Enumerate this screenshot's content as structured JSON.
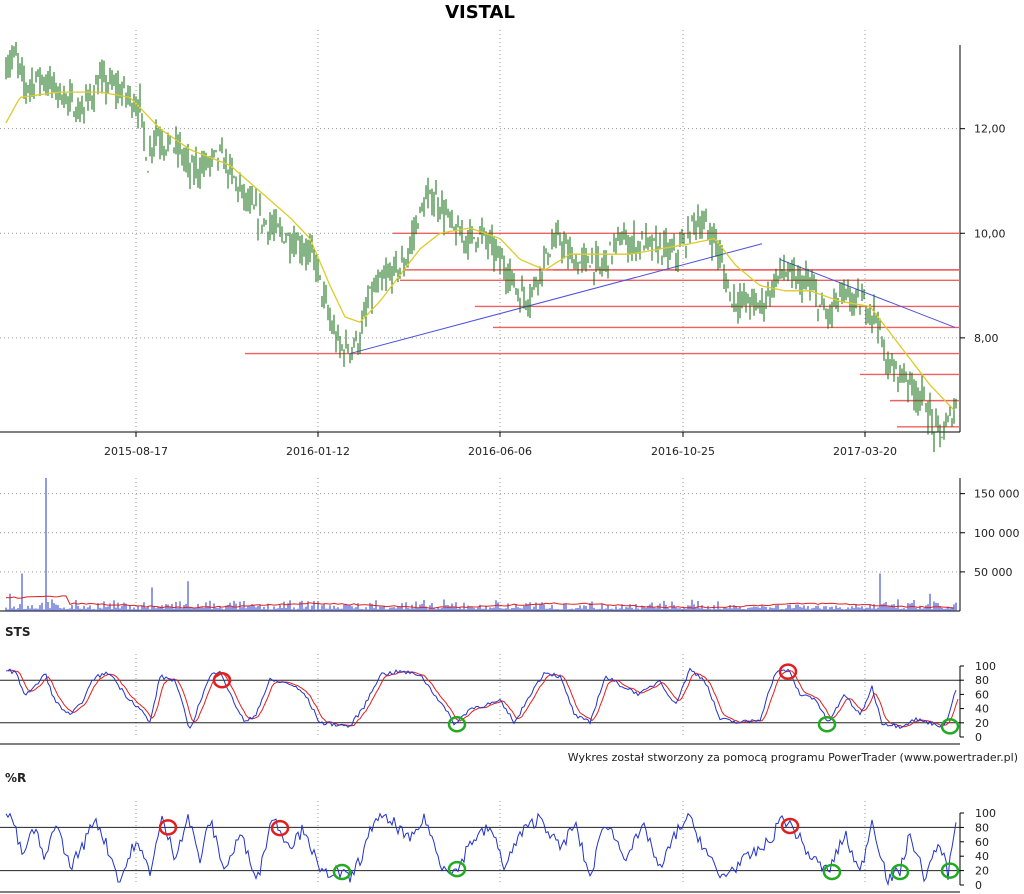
{
  "chart_data": {
    "type": "line",
    "title": "VISTAL",
    "credit": "Wykres został stworzony za pomocą programu PowerTrader (www.powertrader.pl)",
    "x_dates": [
      "2015-08-17",
      "2016-01-12",
      "2016-06-06",
      "2016-10-25",
      "2017-03-20"
    ],
    "colors": {
      "price": "#0b6b0b",
      "ma": "#dccb29",
      "trend": "#4a52e0",
      "levels": "#f06060",
      "volume": "#2233cc",
      "volume_avg": "#e02020",
      "sts_k": "#2233cc",
      "sts_d": "#e02020",
      "wr": "#2233cc",
      "sell_mark": "#e02020",
      "buy_mark": "#22aa22"
    },
    "price": {
      "y_ticks": [
        "12,00",
        "10,00",
        "8,00"
      ],
      "y_values": [
        12,
        10,
        8
      ],
      "ylim": [
        6.2,
        13.6
      ],
      "series_name": "close",
      "anchors": [
        [
          0,
          13.1
        ],
        [
          15,
          13.4
        ],
        [
          25,
          12.8
        ],
        [
          40,
          13.0
        ],
        [
          60,
          12.7
        ],
        [
          80,
          12.3
        ],
        [
          100,
          12.9
        ],
        [
          115,
          12.8
        ],
        [
          130,
          12.6
        ],
        [
          140,
          12.4
        ],
        [
          148,
          11.3
        ],
        [
          155,
          12.0
        ],
        [
          165,
          11.7
        ],
        [
          180,
          11.6
        ],
        [
          190,
          11.2
        ],
        [
          205,
          11.3
        ],
        [
          220,
          11.5
        ],
        [
          235,
          11.0
        ],
        [
          250,
          10.5
        ],
        [
          265,
          10.2
        ],
        [
          280,
          10.0
        ],
        [
          300,
          9.8
        ],
        [
          315,
          9.5
        ],
        [
          322,
          8.9
        ],
        [
          330,
          8.3
        ],
        [
          340,
          7.8
        ],
        [
          350,
          7.8
        ],
        [
          360,
          8.0
        ],
        [
          370,
          8.8
        ],
        [
          380,
          9.0
        ],
        [
          395,
          9.3
        ],
        [
          405,
          9.4
        ],
        [
          415,
          10.1
        ],
        [
          425,
          10.6
        ],
        [
          435,
          10.7
        ],
        [
          445,
          10.4
        ],
        [
          455,
          10.0
        ],
        [
          470,
          9.9
        ],
        [
          480,
          10.0
        ],
        [
          490,
          9.8
        ],
        [
          500,
          9.5
        ],
        [
          510,
          9.2
        ],
        [
          520,
          8.8
        ],
        [
          530,
          8.8
        ],
        [
          540,
          9.3
        ],
        [
          550,
          9.7
        ],
        [
          560,
          9.9
        ],
        [
          568,
          9.6
        ],
        [
          578,
          9.4
        ],
        [
          590,
          9.5
        ],
        [
          600,
          9.3
        ],
        [
          610,
          9.6
        ],
        [
          620,
          9.9
        ],
        [
          630,
          9.8
        ],
        [
          645,
          9.8
        ],
        [
          660,
          9.7
        ],
        [
          675,
          9.6
        ],
        [
          685,
          9.8
        ],
        [
          695,
          10.3
        ],
        [
          705,
          10.1
        ],
        [
          715,
          9.9
        ],
        [
          722,
          9.4
        ],
        [
          730,
          8.8
        ],
        [
          740,
          8.7
        ],
        [
          750,
          8.7
        ],
        [
          760,
          8.6
        ],
        [
          770,
          8.9
        ],
        [
          782,
          9.3
        ],
        [
          795,
          9.1
        ],
        [
          810,
          9.0
        ],
        [
          820,
          8.6
        ],
        [
          828,
          8.4
        ],
        [
          840,
          8.8
        ],
        [
          855,
          8.7
        ],
        [
          868,
          8.6
        ],
        [
          878,
          8.4
        ],
        [
          884,
          7.6
        ],
        [
          892,
          7.4
        ],
        [
          905,
          7.3
        ],
        [
          915,
          7.0
        ],
        [
          925,
          6.8
        ],
        [
          935,
          6.2
        ],
        [
          945,
          6.2
        ],
        [
          955,
          6.7
        ]
      ],
      "ma_anchors": [
        [
          0,
          11.9
        ],
        [
          20,
          12.6
        ],
        [
          60,
          12.7
        ],
        [
          100,
          12.7
        ],
        [
          130,
          12.6
        ],
        [
          160,
          12.0
        ],
        [
          190,
          11.6
        ],
        [
          230,
          11.3
        ],
        [
          260,
          10.8
        ],
        [
          290,
          10.3
        ],
        [
          310,
          9.9
        ],
        [
          330,
          9.0
        ],
        [
          345,
          8.4
        ],
        [
          360,
          8.3
        ],
        [
          380,
          8.7
        ],
        [
          400,
          9.2
        ],
        [
          420,
          9.7
        ],
        [
          440,
          10.0
        ],
        [
          470,
          10.1
        ],
        [
          500,
          9.9
        ],
        [
          520,
          9.5
        ],
        [
          545,
          9.3
        ],
        [
          570,
          9.6
        ],
        [
          600,
          9.6
        ],
        [
          630,
          9.6
        ],
        [
          660,
          9.7
        ],
        [
          690,
          9.8
        ],
        [
          715,
          9.9
        ],
        [
          735,
          9.4
        ],
        [
          760,
          9.0
        ],
        [
          785,
          8.9
        ],
        [
          810,
          8.9
        ],
        [
          840,
          8.7
        ],
        [
          870,
          8.6
        ],
        [
          890,
          8.1
        ],
        [
          910,
          7.6
        ],
        [
          930,
          7.1
        ],
        [
          955,
          6.6
        ]
      ],
      "levels": [
        [
          393,
          960,
          10.0
        ],
        [
          403,
          960,
          9.3
        ],
        [
          400,
          960,
          9.1
        ],
        [
          475,
          960,
          8.6
        ],
        [
          493,
          960,
          8.2
        ],
        [
          553,
          960,
          9.3
        ],
        [
          245,
          960,
          7.7
        ],
        [
          860,
          960,
          7.3
        ],
        [
          890,
          960,
          6.8
        ],
        [
          897,
          960,
          6.3
        ]
      ],
      "trendlines": [
        [
          [
            350,
            7.7
          ],
          [
            762,
            9.8
          ]
        ],
        [
          [
            780,
            9.5
          ],
          [
            955,
            8.2
          ]
        ]
      ]
    },
    "volume": {
      "y_ticks": [
        "150 000",
        "100 000",
        "50 000"
      ],
      "y_values": [
        150000,
        100000,
        50000
      ],
      "ylim": [
        0,
        170000
      ],
      "spikes": [
        [
          9,
          22000
        ],
        [
          22,
          48000
        ],
        [
          45,
          170000
        ],
        [
          152,
          30000
        ],
        [
          188,
          38000
        ],
        [
          880,
          48000
        ],
        [
          930,
          22000
        ]
      ]
    },
    "sts": {
      "label": "STS",
      "y_ticks": [
        "100",
        "80",
        "60",
        "40",
        "20",
        "0"
      ],
      "y_values": [
        100,
        80,
        60,
        40,
        20,
        0
      ],
      "levels": [
        80,
        20
      ],
      "anchors": [
        [
          0,
          95
        ],
        [
          15,
          92
        ],
        [
          25,
          60
        ],
        [
          35,
          70
        ],
        [
          45,
          90
        ],
        [
          55,
          50
        ],
        [
          70,
          30
        ],
        [
          80,
          45
        ],
        [
          95,
          85
        ],
        [
          110,
          90
        ],
        [
          125,
          60
        ],
        [
          140,
          40
        ],
        [
          150,
          20
        ],
        [
          160,
          85
        ],
        [
          175,
          80
        ],
        [
          190,
          10
        ],
        [
          200,
          50
        ],
        [
          210,
          85
        ],
        [
          220,
          95
        ],
        [
          230,
          60
        ],
        [
          245,
          20
        ],
        [
          255,
          30
        ],
        [
          270,
          80
        ],
        [
          290,
          75
        ],
        [
          305,
          60
        ],
        [
          320,
          20
        ],
        [
          335,
          18
        ],
        [
          350,
          15
        ],
        [
          365,
          45
        ],
        [
          380,
          88
        ],
        [
          400,
          92
        ],
        [
          420,
          88
        ],
        [
          440,
          50
        ],
        [
          455,
          18
        ],
        [
          470,
          40
        ],
        [
          485,
          45
        ],
        [
          500,
          50
        ],
        [
          515,
          20
        ],
        [
          530,
          60
        ],
        [
          545,
          92
        ],
        [
          560,
          85
        ],
        [
          575,
          30
        ],
        [
          590,
          20
        ],
        [
          605,
          85
        ],
        [
          625,
          70
        ],
        [
          640,
          60
        ],
        [
          660,
          80
        ],
        [
          675,
          45
        ],
        [
          690,
          95
        ],
        [
          705,
          80
        ],
        [
          720,
          25
        ],
        [
          740,
          20
        ],
        [
          760,
          25
        ],
        [
          775,
          90
        ],
        [
          788,
          95
        ],
        [
          800,
          60
        ],
        [
          815,
          55
        ],
        [
          828,
          20
        ],
        [
          845,
          60
        ],
        [
          860,
          30
        ],
        [
          872,
          70
        ],
        [
          882,
          20
        ],
        [
          900,
          15
        ],
        [
          915,
          25
        ],
        [
          930,
          20
        ],
        [
          945,
          15
        ],
        [
          955,
          65
        ]
      ],
      "sell_marks": [
        [
          222,
          80
        ],
        [
          788,
          92
        ]
      ],
      "buy_marks": [
        [
          457,
          18
        ],
        [
          827,
          18
        ],
        [
          950,
          15
        ]
      ]
    },
    "wr": {
      "label": "%R",
      "y_ticks": [
        "100",
        "80",
        "60",
        "40",
        "20",
        "0"
      ],
      "y_values": [
        100,
        80,
        60,
        40,
        20,
        0
      ],
      "levels": [
        80,
        20
      ],
      "anchors": [
        [
          0,
          100
        ],
        [
          12,
          95
        ],
        [
          22,
          40
        ],
        [
          35,
          80
        ],
        [
          45,
          30
        ],
        [
          55,
          90
        ],
        [
          70,
          25
        ],
        [
          85,
          60
        ],
        [
          95,
          95
        ],
        [
          108,
          50
        ],
        [
          120,
          5
        ],
        [
          135,
          60
        ],
        [
          150,
          20
        ],
        [
          162,
          90
        ],
        [
          175,
          40
        ],
        [
          188,
          95
        ],
        [
          200,
          35
        ],
        [
          210,
          90
        ],
        [
          225,
          20
        ],
        [
          240,
          70
        ],
        [
          258,
          10
        ],
        [
          272,
          95
        ],
        [
          290,
          55
        ],
        [
          305,
          80
        ],
        [
          320,
          15
        ],
        [
          335,
          20
        ],
        [
          350,
          8
        ],
        [
          365,
          50
        ],
        [
          375,
          95
        ],
        [
          395,
          85
        ],
        [
          410,
          60
        ],
        [
          425,
          95
        ],
        [
          440,
          30
        ],
        [
          457,
          18
        ],
        [
          470,
          60
        ],
        [
          490,
          80
        ],
        [
          505,
          25
        ],
        [
          520,
          70
        ],
        [
          540,
          95
        ],
        [
          560,
          50
        ],
        [
          575,
          85
        ],
        [
          590,
          10
        ],
        [
          605,
          90
        ],
        [
          625,
          40
        ],
        [
          645,
          80
        ],
        [
          660,
          20
        ],
        [
          675,
          70
        ],
        [
          688,
          95
        ],
        [
          705,
          50
        ],
        [
          720,
          10
        ],
        [
          745,
          35
        ],
        [
          770,
          60
        ],
        [
          782,
          95
        ],
        [
          795,
          75
        ],
        [
          810,
          40
        ],
        [
          828,
          18
        ],
        [
          845,
          70
        ],
        [
          860,
          15
        ],
        [
          872,
          90
        ],
        [
          888,
          5
        ],
        [
          900,
          20
        ],
        [
          910,
          70
        ],
        [
          925,
          10
        ],
        [
          940,
          60
        ],
        [
          948,
          15
        ],
        [
          956,
          95
        ]
      ],
      "sell_marks": [
        [
          168,
          80
        ],
        [
          280,
          79
        ],
        [
          790,
          82
        ]
      ],
      "buy_marks": [
        [
          342,
          18
        ],
        [
          457,
          22
        ],
        [
          832,
          18
        ],
        [
          900,
          18
        ],
        [
          950,
          20
        ]
      ]
    }
  }
}
